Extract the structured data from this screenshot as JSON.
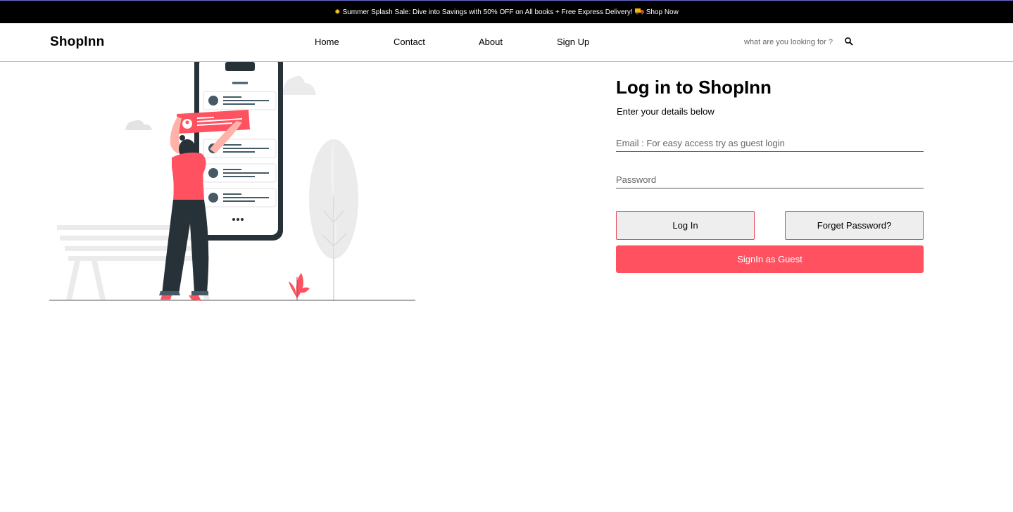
{
  "promo": {
    "text": "Summer Splash Sale: Dive into Savings with 50% OFF on All books + Free Express Delivery!",
    "link": "Shop Now",
    "icons": [
      "sun-icon",
      "truck-icon"
    ]
  },
  "header": {
    "logo": "ShopInn",
    "nav": [
      "Home",
      "Contact",
      "About",
      "Sign Up"
    ],
    "search_placeholder": "what are you looking for ?"
  },
  "login": {
    "title": "Log in to ShopInn",
    "subtitle": "Enter your details below",
    "email_placeholder": "Email : For easy access try as guest login",
    "password_placeholder": "Password",
    "login_label": "Log In",
    "forget_label": "Forget Password?",
    "guest_label": "SignIn as Guest"
  },
  "colors": {
    "accent": "#ff5160",
    "promo_bg": "#000000",
    "button_border": "#e64a5a",
    "illustration_dark": "#263238",
    "illustration_light": "#ebebeb"
  }
}
